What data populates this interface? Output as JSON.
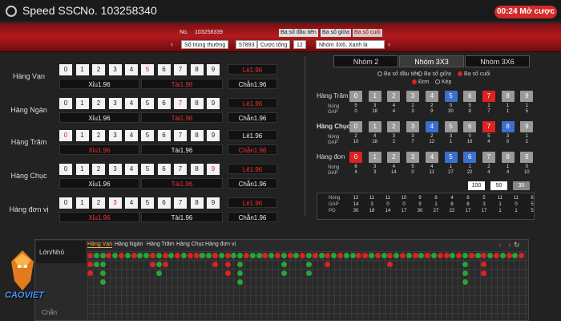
{
  "header": {
    "app_title": "Speed SSC",
    "round_no": "No. 103258340",
    "timer": "00:24 Mở cược"
  },
  "banner": {
    "no_label": "No.",
    "no_value": "103258339",
    "chips": [
      "Ba số đầu tiên",
      "Ba số giữa",
      "Ba số cuối"
    ],
    "won_label": "Số trúng thưởng",
    "won_value": "57893",
    "bet_label": "Cược tổng",
    "bet_value": "12",
    "desc": "Nhóm 3X6, Xanh lá"
  },
  "left": {
    "rows": [
      {
        "label": "Hàng Vạn",
        "red": 5,
        "xiu": "Xỉu1.96",
        "tai": "Tài1.96",
        "le": "Lẻ1.96",
        "chan": "Chẵn1.96",
        "red_xiu": false,
        "red_tai": true,
        "red_le": true,
        "red_chan": false
      },
      {
        "label": "Hàng Ngàn",
        "red": 7,
        "xiu": "Xỉu1.96",
        "tai": "Tài1.96",
        "le": "Lẻ1.96",
        "chan": "Chẵn1.96",
        "red_xiu": false,
        "red_tai": true,
        "red_le": true,
        "red_chan": false
      },
      {
        "label": "Hàng Trăm",
        "red": 0,
        "xiu": "Xỉu1.96",
        "tai": "Tài1.96",
        "le": "Lẻ1.96",
        "chan": "Chẵn1.96",
        "red_xiu": true,
        "red_tai": false,
        "red_le": false,
        "red_chan": true
      },
      {
        "label": "Hàng Chục",
        "red": 9,
        "xiu": "Xỉu1.96",
        "tai": "Tài1.96",
        "le": "Lẻ1.96",
        "chan": "Chẵn1.96",
        "red_xiu": false,
        "red_tai": true,
        "red_le": true,
        "red_chan": false
      },
      {
        "label": "Hàng đơn vị",
        "red": 3,
        "xiu": "Xỉu1.96",
        "tai": "Tài1.96",
        "le": "Lẻ1.96",
        "chan": "Chẵn1.96",
        "red_xiu": true,
        "red_tai": false,
        "red_le": true,
        "red_chan": false
      }
    ]
  },
  "right": {
    "tabs": [
      "Nhóm 2",
      "Nhóm 3X3",
      "Nhóm 3X6"
    ],
    "options": [
      "Ba số đầu tiên",
      "Ba số giữa",
      "Ba số cuối"
    ],
    "modes": [
      "Đơn",
      "Kép"
    ],
    "groups": [
      {
        "label": "Hàng Trăm",
        "blue": [
          5
        ],
        "red": [
          7
        ],
        "nong": [
          5,
          3,
          4,
          2,
          2,
          0,
          5,
          1,
          1,
          1
        ],
        "gap": [
          0,
          18,
          4,
          3,
          9,
          30,
          8,
          7,
          1,
          5
        ]
      },
      {
        "label": "Hàng Chục",
        "blue": [
          4,
          8
        ],
        "red": [
          7
        ],
        "nong": [
          2,
          4,
          3,
          3,
          2,
          3,
          0,
          5,
          3,
          1
        ],
        "gap": [
          10,
          18,
          2,
          7,
          12,
          1,
          16,
          4,
          0,
          2
        ]
      },
      {
        "label": "Hàng đơn",
        "blue": [
          5,
          6
        ],
        "red": [
          0
        ],
        "nong": [
          6,
          3,
          4,
          5,
          4,
          1,
          1,
          2,
          1,
          0
        ],
        "gap": [
          4,
          3,
          14,
          0,
          11,
          27,
          22,
          4,
          4,
          10
        ]
      }
    ],
    "nong_label": "Nóng",
    "gap_label": "GAP",
    "pg_label": "PG",
    "counts": [
      "100",
      "50",
      "30"
    ],
    "stats": {
      "nong": [
        12,
        11,
        11,
        10,
        9,
        6,
        4,
        6,
        5,
        11,
        11,
        6
      ],
      "gap": [
        14,
        3,
        0,
        0,
        9,
        1,
        8,
        8,
        3,
        1,
        0,
        5
      ],
      "pg": [
        30,
        18,
        14,
        17,
        30,
        27,
        22,
        17,
        17,
        1,
        1,
        5
      ]
    }
  },
  "bottom": {
    "category": "Lớn/Nhỏ",
    "category2": "Chẵn",
    "tabs": [
      "Hàng Vạn",
      "Hàng Ngàn",
      "Hàng Trăm",
      "Hàng Chục",
      "Hàng đơn vị"
    ]
  },
  "brand": {
    "mascot_label": "CAOVIET"
  }
}
